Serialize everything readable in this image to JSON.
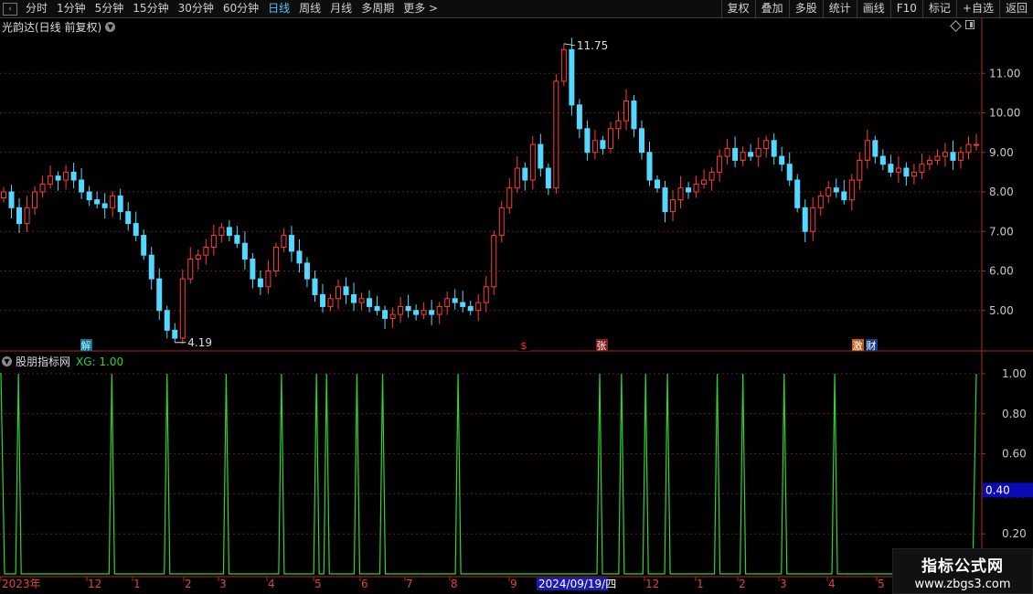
{
  "toolbar": {
    "periods": [
      "分时",
      "1分钟",
      "5分钟",
      "15分钟",
      "30分钟",
      "60分钟",
      "日线",
      "周线",
      "月线",
      "多周期",
      "更多 >"
    ],
    "active_index": 6,
    "right_buttons": [
      "复权",
      "叠加",
      "多股",
      "统计",
      "画线",
      "F10",
      "标记",
      "+自选",
      "返回"
    ]
  },
  "main_title": "光韵达(日线 前复权)",
  "indicator": {
    "name": "股朋指标网",
    "xg_label": "XG: 1.00"
  },
  "cursor_value": "0.40",
  "selected_date": "2024/09/19/四",
  "watermark": {
    "title": "指标公式网",
    "url": "www.zbgs3.com"
  },
  "colors": {
    "up": "#ff3b3b",
    "down": "#54d8ff",
    "indicator_line": "#2fd42f",
    "axis": "#b0271f",
    "grid": "#6b1a1a"
  },
  "chart_data": [
    {
      "type": "candlestick",
      "title": "光韵达(日线 前复权)",
      "ylim": [
        4.0,
        12.0
      ],
      "y_ticks": [
        "5.00",
        "6.00",
        "7.00",
        "8.00",
        "9.00",
        "10.00",
        "11.00"
      ],
      "annotations": [
        {
          "text": "11.75",
          "value": 11.75
        },
        {
          "text": "4.19",
          "value": 4.19
        }
      ],
      "event_markers": [
        "解",
        "$",
        "张",
        "激",
        "财"
      ],
      "close_series": [
        8.0,
        7.6,
        7.2,
        7.6,
        8.0,
        8.2,
        8.4,
        8.3,
        8.5,
        8.3,
        8.0,
        7.8,
        7.7,
        7.6,
        7.9,
        7.5,
        7.2,
        6.9,
        6.4,
        5.8,
        5.0,
        4.5,
        4.3,
        5.8,
        6.3,
        6.4,
        6.6,
        6.9,
        7.1,
        6.9,
        6.7,
        6.3,
        5.8,
        5.6,
        6.0,
        6.6,
        6.9,
        6.5,
        6.2,
        5.8,
        5.4,
        5.1,
        5.3,
        5.6,
        5.4,
        5.2,
        5.3,
        5.1,
        5.0,
        4.8,
        4.9,
        5.1,
        5.0,
        4.9,
        5.0,
        4.9,
        5.1,
        5.3,
        5.2,
        5.1,
        5.0,
        5.2,
        5.6,
        6.9,
        7.6,
        8.1,
        8.6,
        8.3,
        9.2,
        8.6,
        8.1,
        10.8,
        11.6,
        10.2,
        9.6,
        9.0,
        9.3,
        9.1,
        9.6,
        9.8,
        10.3,
        9.6,
        9.0,
        8.3,
        8.1,
        7.5,
        7.8,
        8.1,
        8.0,
        8.2,
        8.3,
        8.5,
        8.9,
        9.1,
        8.8,
        9.0,
        8.9,
        9.1,
        9.3,
        8.9,
        8.7,
        8.3,
        7.6,
        7.0,
        7.6,
        7.9,
        8.1,
        8.0,
        7.8,
        8.3,
        8.8,
        9.3,
        8.9,
        8.7,
        8.5,
        8.6,
        8.4,
        8.5,
        8.7,
        8.8,
        8.9,
        9.0,
        8.8,
        9.0,
        9.2,
        9.2
      ]
    },
    {
      "type": "line",
      "name": "XG",
      "ylim": [
        0,
        1.05
      ],
      "y_ticks": [
        "0.20",
        "0.40",
        "0.60",
        "0.80",
        "1.00"
      ],
      "spike_positions": [
        0.2,
        1.9,
        13.9,
        21.0,
        28.6,
        35.7,
        40.2,
        41.5,
        45.4,
        48.7,
        58.4,
        76.6,
        79.4,
        82.5,
        85.3,
        91.7,
        95.0,
        100.3,
        106.8
      ],
      "x_tick_labels": [
        "2023年",
        "12",
        "1",
        "2",
        "3",
        "4",
        "5",
        "6",
        "7",
        "8",
        "9",
        "2024/09/19/四",
        "12",
        "1",
        "2",
        "3",
        "4",
        "5"
      ]
    }
  ]
}
